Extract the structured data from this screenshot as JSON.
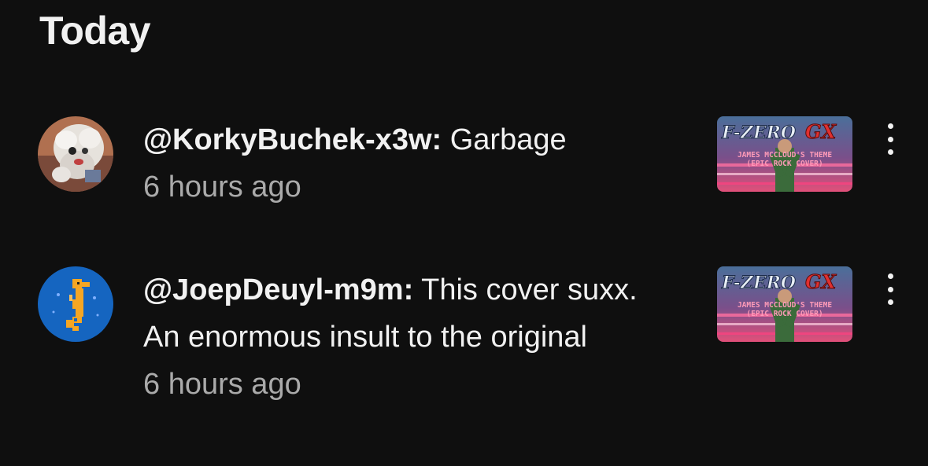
{
  "section": {
    "title": "Today"
  },
  "notifications": [
    {
      "handle": "@KorkyBuchek-x3w:",
      "message": " Garbage",
      "time": "6 hours ago",
      "avatar_icon": "user-avatar-fluffy-white",
      "thumbnail": {
        "title_a": "F-ZERO",
        "title_b": "GX",
        "line1": "JAMES MCCLOUD'S THEME",
        "line2": "(EPIC ROCK COVER)"
      }
    },
    {
      "handle": "@JoepDeuyl-m9m:",
      "message": " This cover suxx. An enormous insult to the original",
      "time": "6 hours ago",
      "avatar_icon": "seahorse-avatar",
      "thumbnail": {
        "title_a": "F-ZERO",
        "title_b": "GX",
        "line1": "JAMES MCCLOUD'S THEME",
        "line2": "(EPIC ROCK COVER)"
      }
    }
  ],
  "colors": {
    "background": "#0f0f0f",
    "text": "#f1f1f1",
    "secondary_text": "#aaaaaa",
    "avatar2_bg": "#1565c0"
  }
}
